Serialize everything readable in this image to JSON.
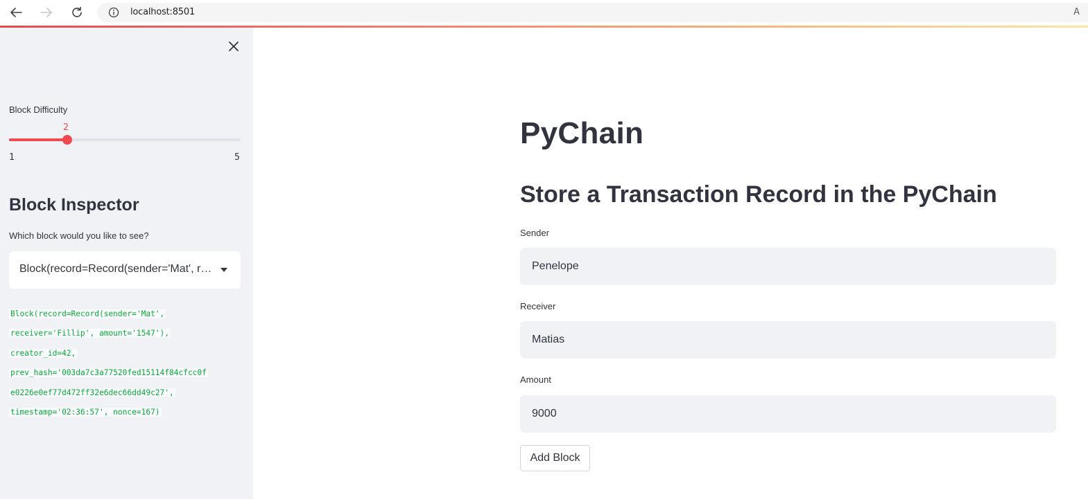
{
  "browser": {
    "url": "localhost:8501",
    "back_icon": "arrow-left-icon",
    "forward_icon": "arrow-right-icon",
    "reload_icon": "reload-icon",
    "info_icon": "info-icon",
    "read_aloud_icon": "read-aloud-icon",
    "read_aloud_label": "A"
  },
  "sidebar": {
    "close_icon": "close-icon",
    "slider": {
      "label": "Block Difficulty",
      "value": "2",
      "min": "1",
      "max": "5",
      "fraction": 0.25,
      "accent_color": "#ee4a4f"
    },
    "inspector_heading": "Block Inspector",
    "select_label": "Which block would you like to see?",
    "select_value": "Block(record=Record(sender='Mat', receiver='Fillip', amount='1547'), creator_id=42, prev_hash='003da7c3a77520fed15114f84cfcc0fe0226e0ef77d472ff32e6dec66dd49c27', timestamp='02:36:57', nonce=167)",
    "code_lines": [
      "Block(record=Record(sender='Mat',",
      "receiver='Fillip', amount='1547'),",
      "creator_id=42,",
      "prev_hash='003da7c3a77520fed15114f84cfcc0f",
      "e0226e0ef77d472ff32e6dec66dd49c27',",
      "timestamp='02:36:57', nonce=167)"
    ]
  },
  "main": {
    "title": "PyChain",
    "subtitle": "Store a Transaction Record in the PyChain",
    "fields": {
      "sender": {
        "label": "Sender",
        "value": "Penelope"
      },
      "receiver": {
        "label": "Receiver",
        "value": "Matias"
      },
      "amount": {
        "label": "Amount",
        "value": "9000"
      }
    },
    "add_button": "Add Block"
  }
}
